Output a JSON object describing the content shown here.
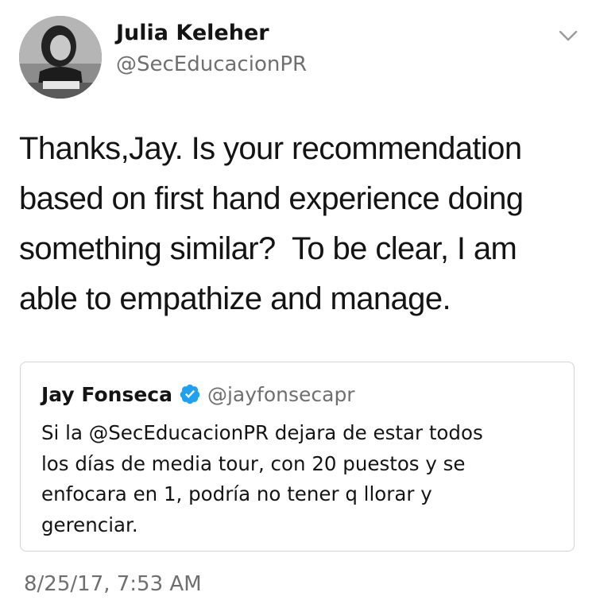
{
  "tweet": {
    "author": {
      "name": "Julia Keleher",
      "handle": "@SecEducacionPR"
    },
    "text": "Thanks,Jay. Is your recommendation\nbased on first hand experience doing\nsomething similar?  To be clear, I am\nable to empathize and manage.",
    "timestamp": "8/25/17, 7:53 AM",
    "menu_icon": "chevron-down-icon",
    "avatar_icon": "profile-photo"
  },
  "quoted_tweet": {
    "author": {
      "name": "Jay Fonseca",
      "handle": "@jayfonsecapr",
      "verified_icon": "verified-badge-icon"
    },
    "text": "Si la @SecEducacionPR dejara de estar todos\nlos días de media tour, con 20 puestos y se\nenfocara en 1, podría no tener q llorar y\ngerenciar."
  },
  "colors": {
    "text": "#141414",
    "secondary": "#6f6f6f",
    "border": "#d4d4d4",
    "verified": "#1da1f2"
  }
}
